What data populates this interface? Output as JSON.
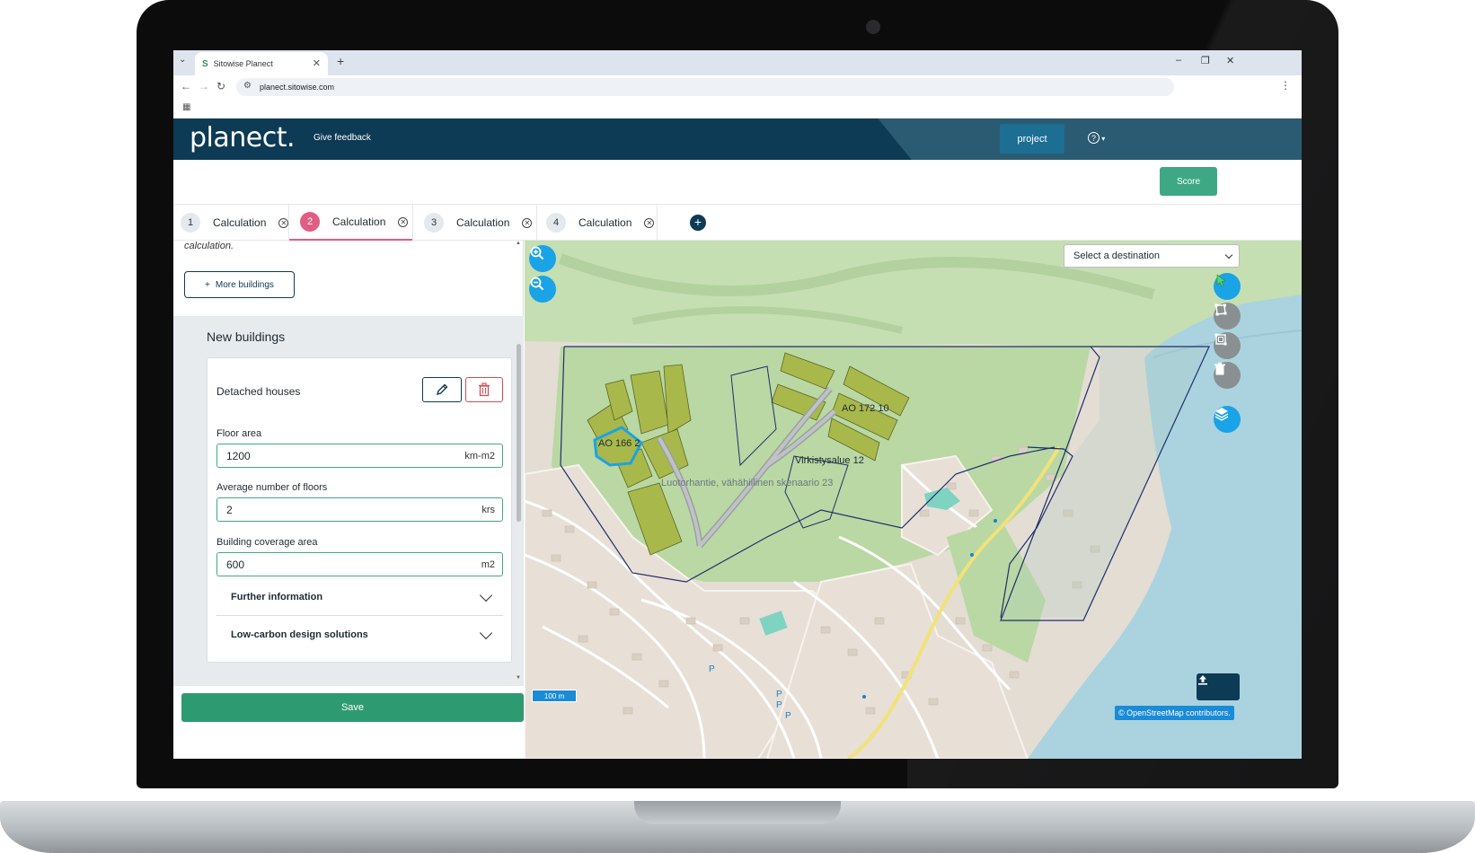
{
  "browser": {
    "tab_title": "Sitowise Planect",
    "favicon": "S",
    "url": "planect.sitowise.com"
  },
  "header": {
    "logo": "planect.",
    "feedback_link": "Give feedback",
    "project_button": "project",
    "help_icon": "help-circle-icon",
    "help_symbol": "?",
    "brand_color": "#0d3a55"
  },
  "toolbar": {
    "score_button": "Score",
    "score_color": "#3ea885"
  },
  "calc_tabs": [
    {
      "number": "1",
      "label": "Calculation",
      "active": false
    },
    {
      "number": "2",
      "label": "Calculation",
      "active": true
    },
    {
      "number": "3",
      "label": "Calculation",
      "active": false
    },
    {
      "number": "4",
      "label": "Calculation",
      "active": false
    }
  ],
  "active_tab_color": "#e25d83",
  "left_panel": {
    "note_text": "calculation.",
    "more_buildings_button": "More buildings",
    "new_buildings_title": "New buildings",
    "building_card": {
      "title": "Detached houses",
      "edit_icon": "pencil-icon",
      "delete_icon": "trash-icon",
      "fields": [
        {
          "label": "Floor area",
          "value": "1200",
          "unit": "km-m2"
        },
        {
          "label": "Average number of floors",
          "value": "2",
          "unit": "krs"
        },
        {
          "label": "Building coverage area",
          "value": "600",
          "unit": "m2"
        }
      ],
      "accordions": [
        "Further information",
        "Low-carbon design solutions"
      ]
    },
    "save_button": "Save"
  },
  "map": {
    "destination_select": "Select a destination",
    "labels": {
      "parcel_a": "AO 166 2",
      "parcel_b": "AO 172 10",
      "area_label": "Virkistysalue 12",
      "scenario_label": "Luotorhantie, vähähiilinen skenaario 23"
    },
    "scale": "100 m",
    "attribution": "© OpenStreetMap contributors.",
    "tools": [
      "zoom-in-icon",
      "zoom-out-icon",
      "select-cursor-icon",
      "draw-polygon-icon",
      "draw-rectangle-icon",
      "trash-icon",
      "layers-icon",
      "export-icon"
    ],
    "accent_color": "#1aa3e6"
  }
}
